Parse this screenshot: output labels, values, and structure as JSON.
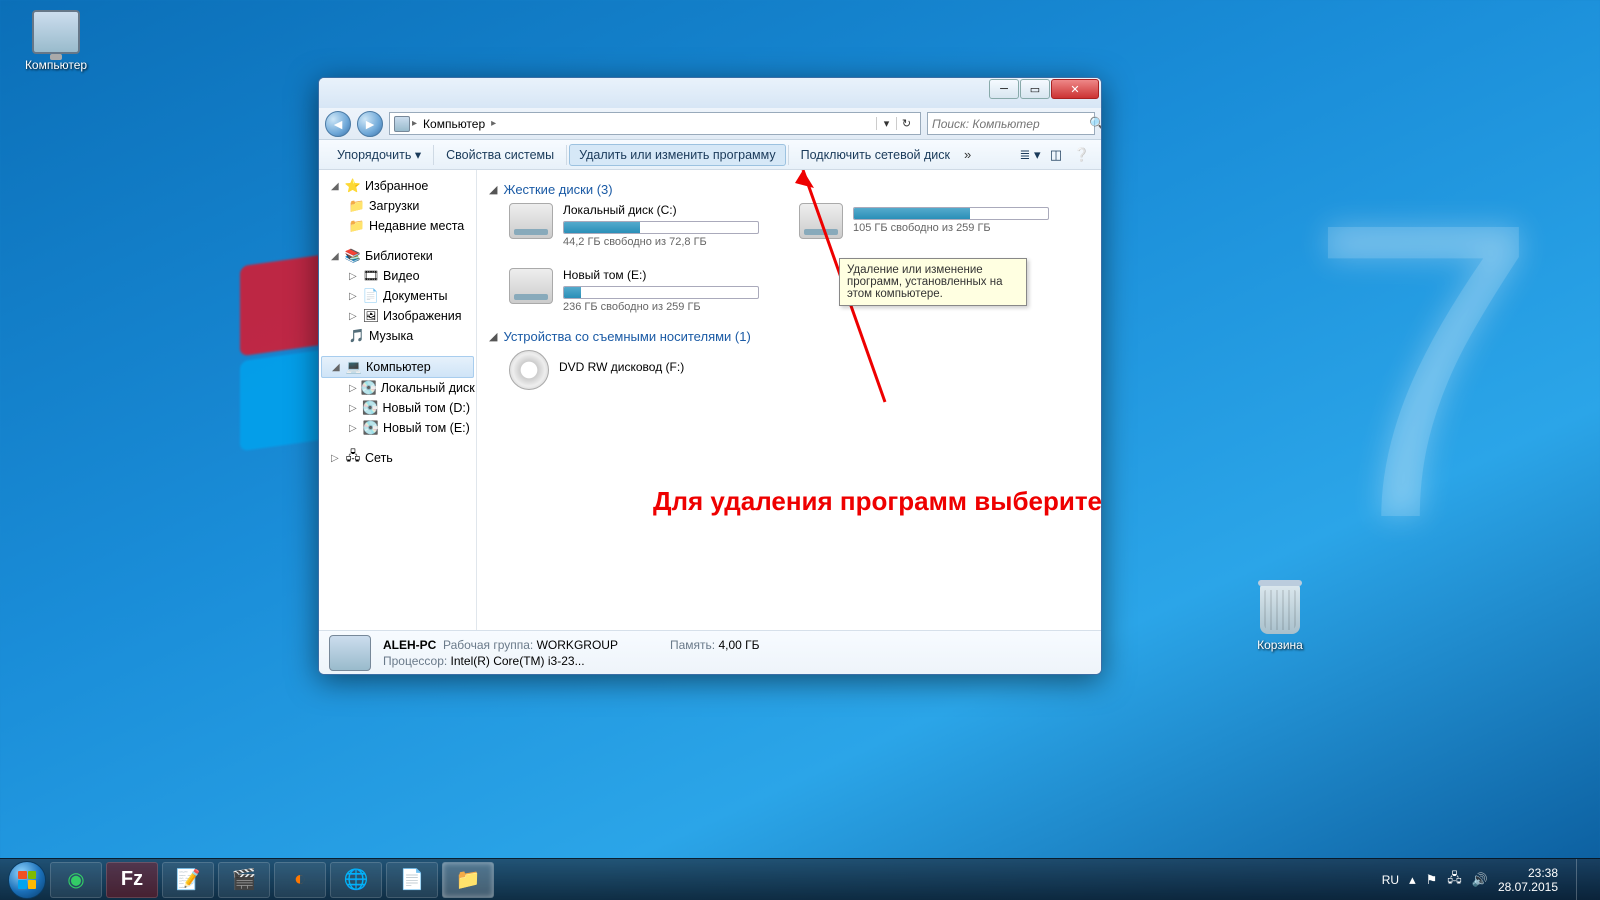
{
  "desktop": {
    "computer": "Компьютер",
    "recycle": "Корзина"
  },
  "window": {
    "nav": {
      "computer": "Компьютер"
    },
    "search_placeholder": "Поиск: Компьютер",
    "toolbar": {
      "organize": "Упорядочить ▾",
      "properties": "Свойства системы",
      "uninstall": "Удалить или изменить программу",
      "mapdrive": "Подключить сетевой диск"
    },
    "tooltip": "Удаление или изменение программ, установленных на этом компьютере.",
    "sidebar": {
      "favorites": "Избранное",
      "downloads": "Загрузки",
      "recent": "Недавние места",
      "libraries": "Библиотеки",
      "video": "Видео",
      "documents": "Документы",
      "pictures": "Изображения",
      "music": "Музыка",
      "computer": "Компьютер",
      "localC": "Локальный диск (C:)",
      "volD": "Новый том (D:)",
      "volE": "Новый том (E:)",
      "network": "Сеть"
    },
    "sections": {
      "hdd": "Жесткие диски (3)",
      "removable": "Устройства со съемными носителями (1)"
    },
    "drives": {
      "c": {
        "name": "Локальный диск (C:)",
        "free": "44,2 ГБ свободно из 72,8 ГБ",
        "fill": 39
      },
      "d": {
        "name": "",
        "free": "105 ГБ свободно из 259 ГБ",
        "fill": 60
      },
      "e": {
        "name": "Новый том (E:)",
        "free": "236 ГБ свободно из 259 ГБ",
        "fill": 9
      },
      "dvd": {
        "name": "DVD RW дисковод (F:)"
      }
    },
    "details": {
      "pcname": "ALEH-PC",
      "workgroup_lbl": "Рабочая группа:",
      "workgroup": "WORKGROUP",
      "memory_lbl": "Память:",
      "memory": "4,00 ГБ",
      "cpu_lbl": "Процессор:",
      "cpu": "Intel(R) Core(TM) i3-23..."
    }
  },
  "annotation": "Для удаления программ выберите",
  "tray": {
    "lang": "RU",
    "time": "23:38",
    "date": "28.07.2015"
  }
}
